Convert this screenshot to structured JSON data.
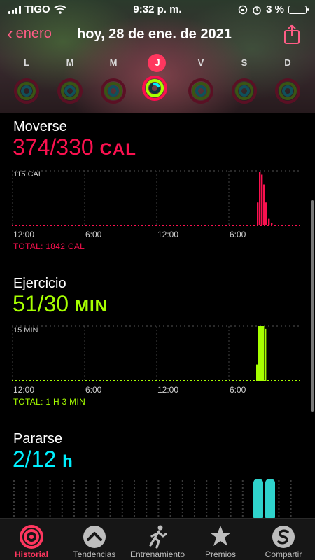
{
  "status": {
    "carrier": "TIGO",
    "time": "9:32 p. m.",
    "battery": "3 %",
    "battery_level": 0.03
  },
  "nav": {
    "back_label": "enero",
    "title": "hoy, 28 de ene. de 2021"
  },
  "week": {
    "days": [
      "L",
      "M",
      "M",
      "J",
      "V",
      "S",
      "D"
    ],
    "today_index": 3
  },
  "sections": {
    "move": {
      "title": "Moverse",
      "value": "374/330",
      "unit": "CAL",
      "scale": "115 CAL",
      "total": "TOTAL: 1842 CAL",
      "color": "#fa114f"
    },
    "exercise": {
      "title": "Ejercicio",
      "value": "51/30",
      "unit": "MIN",
      "scale": "15 MIN",
      "total": "TOTAL: 1 H 3 MIN",
      "color": "#a6ff00"
    },
    "stand": {
      "title": "Pararse",
      "value": "2/12",
      "unit": "h",
      "color": "#00f0ff"
    }
  },
  "time_ticks": [
    "12:00",
    "6:00",
    "12:00",
    "6:00"
  ],
  "tabs": [
    {
      "label": "Historial",
      "icon": "history-rings-icon",
      "active": true
    },
    {
      "label": "Tendencias",
      "icon": "trends-chevron-icon",
      "active": false
    },
    {
      "label": "Entrenamiento",
      "icon": "running-figure-icon",
      "active": false
    },
    {
      "label": "Premios",
      "icon": "award-star-icon",
      "active": false
    },
    {
      "label": "Compartir",
      "icon": "share-s-icon",
      "active": false
    }
  ]
}
